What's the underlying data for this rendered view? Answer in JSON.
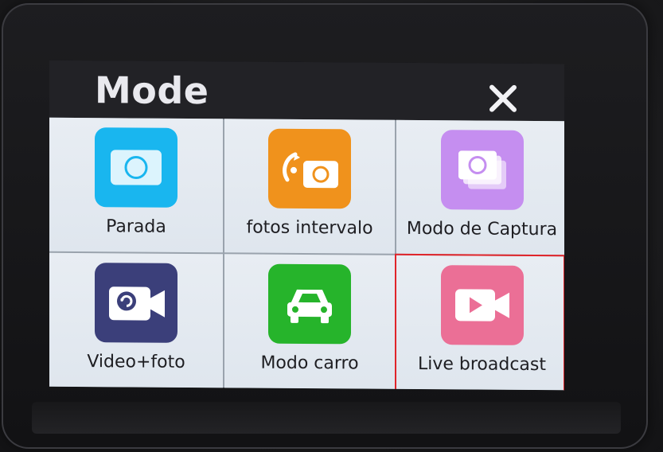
{
  "header": {
    "title": "Mode",
    "close_icon": "close-icon"
  },
  "modes": [
    {
      "label": "Parada",
      "icon": "photo-camera-icon",
      "color": "#19b6ef",
      "selected": false
    },
    {
      "label": "fotos intervalo",
      "icon": "interval-photo-icon",
      "color": "#f0921c",
      "selected": false
    },
    {
      "label": "Modo de Captura",
      "icon": "burst-capture-icon",
      "color": "#c58ef0",
      "selected": false
    },
    {
      "label": "Video+foto",
      "icon": "video-photo-icon",
      "color": "#3b3f7a",
      "selected": false
    },
    {
      "label": "Modo  carro",
      "icon": "car-icon",
      "color": "#26b42b",
      "selected": false
    },
    {
      "label": "Live broadcast",
      "icon": "live-video-icon",
      "color": "#eb6f96",
      "selected": true
    }
  ],
  "colors": {
    "selection_border": "#e0242a",
    "header_bg": "#222226",
    "tile_bg": "#e8edf3"
  }
}
